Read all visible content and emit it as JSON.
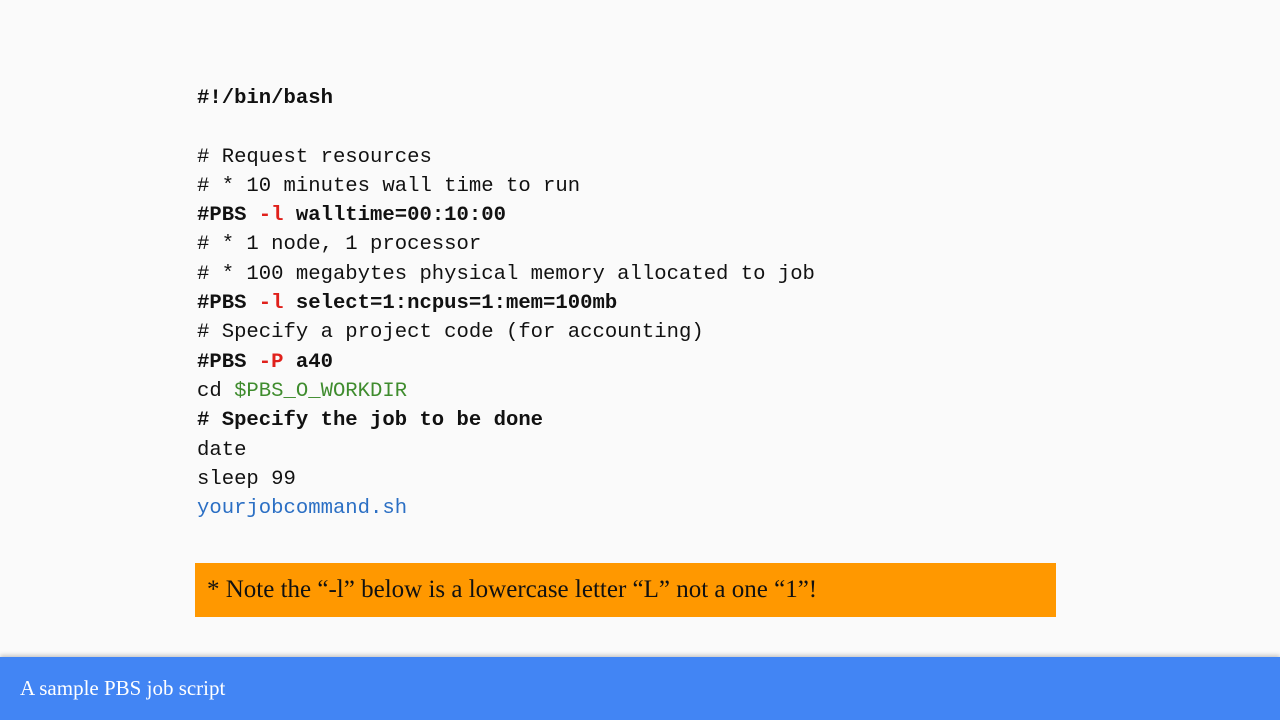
{
  "script_lines": [
    [
      {
        "text": "#!/bin/bash",
        "style": "b"
      }
    ],
    [],
    [
      {
        "text": "# Request resources",
        "style": ""
      }
    ],
    [
      {
        "text": "# * 10 minutes wall time to run",
        "style": ""
      }
    ],
    [
      {
        "text": "#PBS ",
        "style": "b"
      },
      {
        "text": "-l",
        "style": "b red"
      },
      {
        "text": " walltime=00:10:00",
        "style": "b"
      }
    ],
    [
      {
        "text": "# * 1 node, 1 processor",
        "style": ""
      }
    ],
    [
      {
        "text": "# * 100 megabytes physical memory allocated to job",
        "style": ""
      }
    ],
    [
      {
        "text": "#PBS ",
        "style": "b"
      },
      {
        "text": "-l",
        "style": "b red"
      },
      {
        "text": " select=1:ncpus=1:mem=100mb",
        "style": "b"
      }
    ],
    [
      {
        "text": "# Specify a project code (for accounting)",
        "style": ""
      }
    ],
    [
      {
        "text": "#PBS ",
        "style": "b"
      },
      {
        "text": "-P",
        "style": "b red"
      },
      {
        "text": " a40",
        "style": "b"
      }
    ],
    [
      {
        "text": "cd ",
        "style": ""
      },
      {
        "text": "$PBS_O_WORKDIR",
        "style": "green"
      }
    ],
    [
      {
        "text": "# Specify the job to be done",
        "style": "b"
      }
    ],
    [
      {
        "text": "date",
        "style": ""
      }
    ],
    [
      {
        "text": "sleep 99",
        "style": ""
      }
    ],
    [
      {
        "text": "yourjobcommand.sh",
        "style": "blue"
      }
    ]
  ],
  "note": "* Note the “-l” below is a lowercase letter “L” not a one “1”!",
  "footer": {
    "title": "A sample PBS job script"
  },
  "colors": {
    "note_bg": "#ff9800",
    "footer_bg": "#4285f4",
    "flag": "#e0201b",
    "variable": "#3f8c2e",
    "command": "#2b6fc4"
  }
}
